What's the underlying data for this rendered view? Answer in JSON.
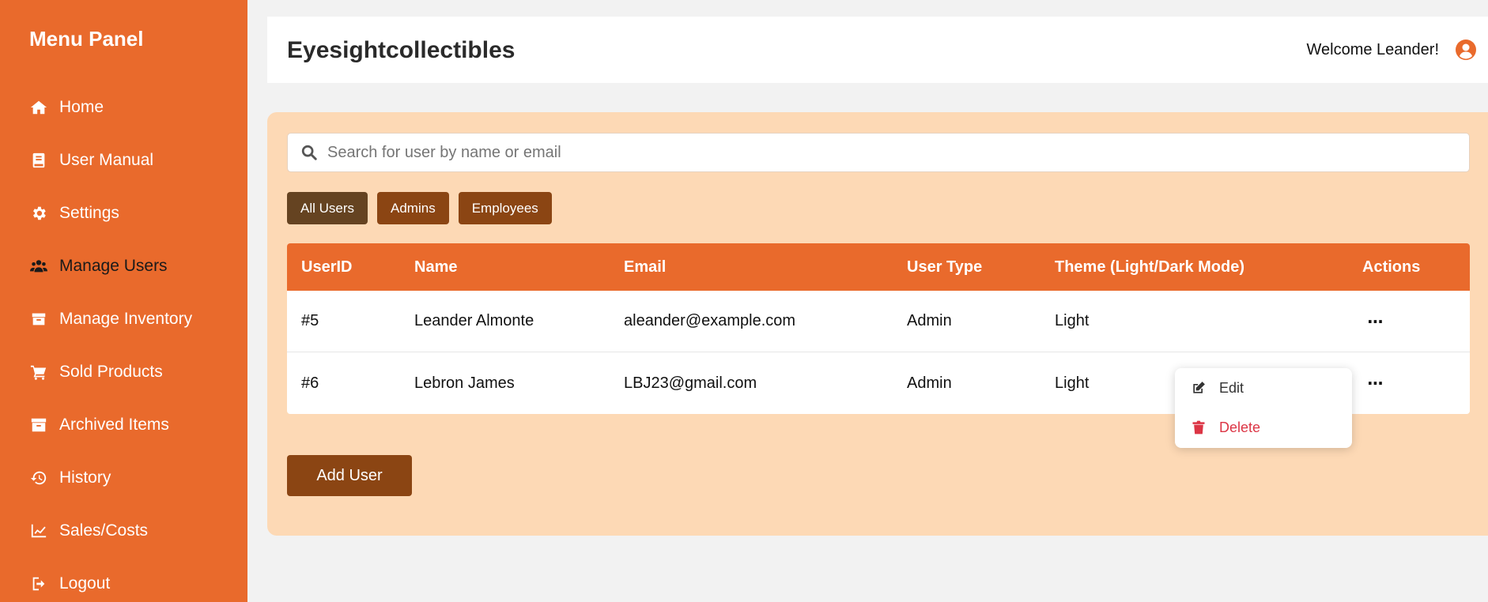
{
  "sidebar": {
    "title": "Menu Panel",
    "items": [
      {
        "label": "Home",
        "icon": "home-icon"
      },
      {
        "label": "User Manual",
        "icon": "book-icon"
      },
      {
        "label": "Settings",
        "icon": "gear-icon"
      },
      {
        "label": "Manage Users",
        "icon": "users-icon",
        "active": true
      },
      {
        "label": "Manage Inventory",
        "icon": "box-icon"
      },
      {
        "label": "Sold Products",
        "icon": "cart-icon"
      },
      {
        "label": "Archived Items",
        "icon": "archive-icon"
      },
      {
        "label": "History",
        "icon": "history-icon"
      },
      {
        "label": "Sales/Costs",
        "icon": "chart-line-icon"
      },
      {
        "label": "Logout",
        "icon": "logout-icon"
      }
    ]
  },
  "header": {
    "brand": "Eyesightcollectibles",
    "welcome": "Welcome Leander!"
  },
  "search": {
    "placeholder": "Search for user by name or email",
    "value": ""
  },
  "filters": {
    "all": "All Users",
    "admins": "Admins",
    "employees": "Employees"
  },
  "table": {
    "headers": [
      "UserID",
      "Name",
      "Email",
      "User Type",
      "Theme (Light/Dark Mode)",
      "Actions"
    ],
    "rows": [
      {
        "id": "#5",
        "name": "Leander Almonte",
        "email": "aleander@example.com",
        "type": "Admin",
        "theme": "Light"
      },
      {
        "id": "#6",
        "name": "Lebron James",
        "email": "LBJ23@gmail.com",
        "type": "Admin",
        "theme": "Light"
      }
    ],
    "actions_glyph": "···"
  },
  "dropdown": {
    "edit": "Edit",
    "delete": "Delete"
  },
  "add_user_label": "Add User",
  "colors": {
    "accent": "#e96a2c",
    "brown": "#8b4513",
    "dark_brown": "#654321",
    "panel_bg": "#fdd9b5",
    "danger": "#dc3545"
  }
}
